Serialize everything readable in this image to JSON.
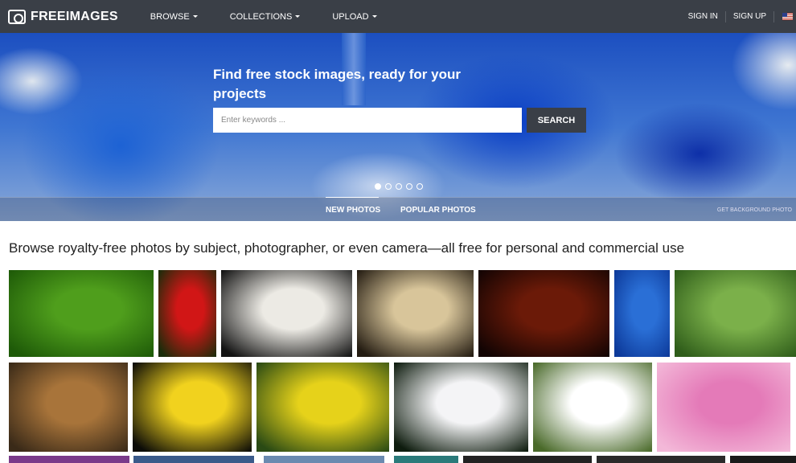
{
  "brand": {
    "name": "FREEIMAGES"
  },
  "nav": {
    "browse": "BROWSE",
    "collections": "COLLECTIONS",
    "upload": "UPLOAD",
    "sign_in": "SIGN IN",
    "sign_up": "SIGN UP"
  },
  "hero": {
    "title": "Find free stock images, ready for your projects",
    "search_placeholder": "Enter keywords ...",
    "search_button": "SEARCH",
    "slides": 5,
    "active_slide": 1,
    "tabs": [
      "NEW PHOTOS",
      "POPULAR PHOTOS"
    ],
    "active_tab": "NEW PHOTOS",
    "get_background": "GET BACKGROUND PHOTO"
  },
  "content": {
    "subtitle": "Browse royalty-free photos by subject, photographer, or even camera—all free for personal and commercial use"
  },
  "thumbnails": [
    {
      "subject": "fern",
      "colors": [
        "#4f9e1c",
        "#1e5a08"
      ]
    },
    {
      "subject": "red tulip",
      "colors": [
        "#d11616",
        "#1a2c0a"
      ]
    },
    {
      "subject": "bald eagle",
      "colors": [
        "#eceae4",
        "#131313"
      ]
    },
    {
      "subject": "sunset",
      "colors": [
        "#d8c59a",
        "#241c12"
      ]
    },
    {
      "subject": "oil lamp",
      "colors": [
        "#6b1a08",
        "#120403"
      ]
    },
    {
      "subject": "flower on water",
      "colors": [
        "#2a6fd6",
        "#0d3a9a"
      ]
    },
    {
      "subject": "grasshopper",
      "colors": [
        "#7bb04a",
        "#2f5d1a"
      ]
    },
    {
      "subject": "coins",
      "colors": [
        "#a8743a",
        "#3a2a18"
      ]
    },
    {
      "subject": "yellow hibiscus",
      "colors": [
        "#f1d21e",
        "#0c0c08"
      ]
    },
    {
      "subject": "bee on yellow flowers",
      "colors": [
        "#e6d21a",
        "#2a4a14"
      ]
    },
    {
      "subject": "white lotus",
      "colors": [
        "#f4f4f6",
        "#0e1c0e"
      ]
    },
    {
      "subject": "daisies",
      "colors": [
        "#ffffff",
        "#4a6a2a"
      ]
    },
    {
      "subject": "pink lotus",
      "colors": [
        "#e47ab8",
        "#f3b8d8"
      ]
    }
  ]
}
